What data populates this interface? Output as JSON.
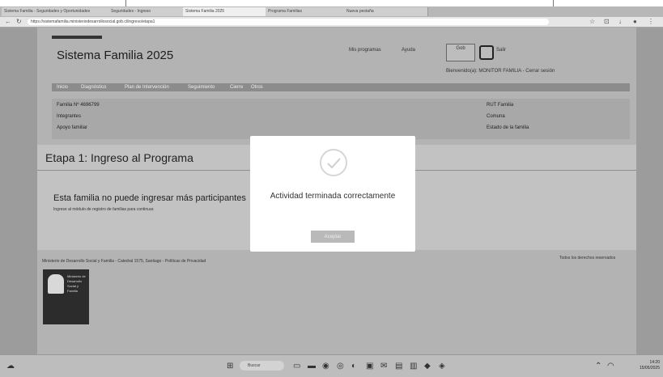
{
  "browser": {
    "tabs": [
      {
        "label": "Sistema Familia - Seguridades y Oportunidades"
      },
      {
        "label": "Seguridades - Ingreso"
      },
      {
        "label": "Sistema Familia 2025"
      },
      {
        "label": "Programa Familias"
      },
      {
        "label": "Nueva pestaña"
      }
    ],
    "url": "https://sistemafamilia.ministeriodesarrollosocial.gob.cl/ingreso/etapa1"
  },
  "site": {
    "title": "Sistema Familia 2025",
    "header_links": [
      "Mis programas",
      "Ayuda",
      "Salir"
    ],
    "gob_logo_label": "Gob",
    "user_line": "Bienvenido(a): MONITOR FAMILIA - Cerrar sesión"
  },
  "menu": {
    "items": [
      "Inicio",
      "Diagnóstico",
      "Plan de Intervención",
      "Seguimiento",
      "Cierre",
      "Otros"
    ]
  },
  "family_info": {
    "left": [
      "Familia Nº 4696799",
      "Integrantes",
      "Apoyo familiar"
    ],
    "right": [
      "RUT Familia",
      "Comuna",
      "Estado de la familia"
    ]
  },
  "stage": {
    "title": "Etapa 1: Ingreso al Programa",
    "text": "Esta familia no puede ingresar más participantes",
    "subtext": "Ingrese al módulo de registro de familias para continuar."
  },
  "footer": {
    "links": "Ministerio de Desarrollo Social y Familia - Catedral 1575, Santiago - Políticas de Privacidad",
    "right": "Todos los derechos reservados",
    "emblem_text": "Ministerio de Desarrollo Social y Familia"
  },
  "modal": {
    "title": "Actividad terminada correctamente",
    "button_label": "Aceptar"
  },
  "taskbar": {
    "search_placeholder": "Buscar",
    "time": "14:20",
    "date": "15/05/2025"
  }
}
